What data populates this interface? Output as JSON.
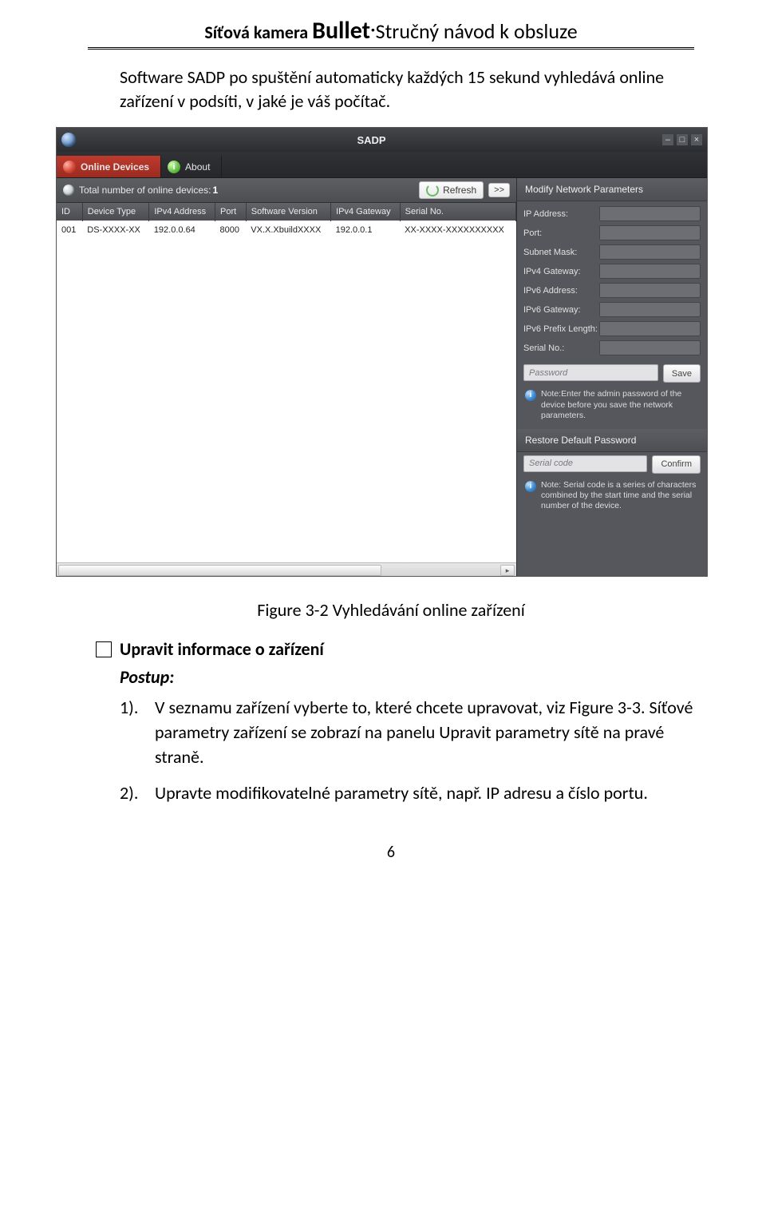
{
  "header": {
    "pre": "Síťová kamera ",
    "big": "Bullet",
    "dot": "·",
    "post": "Stručný návod k obsluze"
  },
  "intro": "Software SADP po spuštění automaticky každých 15 sekund vyhledává online zařízení v podsíti, v jaké je váš počítač.",
  "sadp": {
    "title": "SADP",
    "win": {
      "min": "–",
      "max": "□",
      "close": "×"
    },
    "tabs": {
      "online": "Online Devices",
      "about": "About"
    },
    "total_label": "Total number of online devices: ",
    "total_count": "1",
    "refresh": "Refresh",
    "expand": ">>",
    "cols": {
      "id": "ID",
      "type": "Device Type",
      "ipv4": "IPv4 Address",
      "port": "Port",
      "sw": "Software Version",
      "gw": "IPv4 Gateway",
      "serial": "Serial No."
    },
    "row": {
      "id": "001",
      "type": "DS-XXXX-XX",
      "ipv4": "192.0.0.64",
      "port": "8000",
      "sw": "VX.X.XbuildXXXX",
      "gw": "192.0.0.1",
      "serial": "XX-XXXX-XXXXXXXXXX"
    },
    "right": {
      "head1": "Modify Network Parameters",
      "fields": {
        "ip": "IP Address:",
        "port": "Port:",
        "subnet": "Subnet Mask:",
        "gw4": "IPv4 Gateway:",
        "ip6": "IPv6 Address:",
        "gw6": "IPv6 Gateway:",
        "plen": "IPv6 Prefix Length:",
        "serial": "Serial No.:"
      },
      "password_ph": "Password",
      "save": "Save",
      "note1": "Note:Enter the admin password of the device before you save the network parameters.",
      "head2": "Restore Default Password",
      "serialcode_ph": "Serial code",
      "confirm": "Confirm",
      "note2": "Note: Serial code is a series of characters combined by the start time and the serial number of the device."
    }
  },
  "caption": "Figure 3-2 Vyhledávání online zařízení",
  "section_title": "Upravit informace o zařízení",
  "postup": "Postup:",
  "steps": {
    "s1_num": "1).",
    "s1": "V seznamu zařízení vyberte to, které chcete upravovat, viz Figure 3-3. Síťové parametry zařízení se zobrazí na panelu Upravit parametry sítě na pravé straně.",
    "s2_num": "2).",
    "s2": "Upravte modifikovatelné parametry sítě, např. IP adresu a číslo portu."
  },
  "page_num": "6"
}
